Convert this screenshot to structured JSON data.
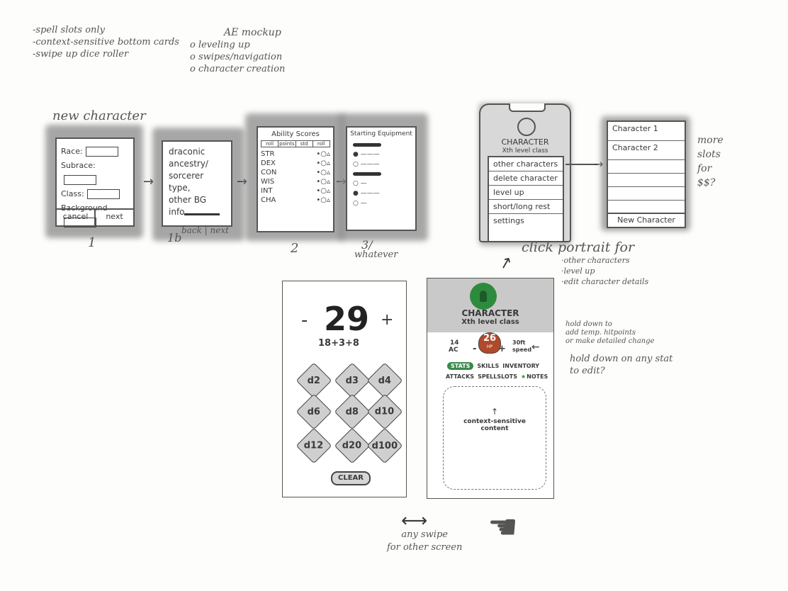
{
  "notes_left": [
    "-spell slots only",
    "-context-sensitive bottom cards",
    "-swipe up dice roller"
  ],
  "ae_mockup": {
    "title": "AE mockup",
    "items": [
      "o leveling up",
      "o swipes/navigation",
      "o character creation"
    ]
  },
  "new_character": {
    "title": "new character",
    "screen1": {
      "fields": [
        "Race:",
        "Subrace:",
        "Class:",
        "Background"
      ],
      "cancel": "cancel",
      "next": "next",
      "number": "1"
    },
    "screen1b": {
      "lines": [
        "draconic",
        "ancestry/",
        "sorcerer type,",
        "other BG",
        "info"
      ],
      "caption": "back | next",
      "number": "1b"
    },
    "screen2": {
      "title": "Ability Scores",
      "tabs": [
        "roll",
        "points",
        "std",
        "roll"
      ],
      "stats": [
        "STR",
        "DEX",
        "CON",
        "WIS",
        "INT",
        "CHA"
      ],
      "number": "2"
    },
    "screen3": {
      "title": "Starting Equipment",
      "number": "3/",
      "caption": "whatever"
    }
  },
  "character_menu": {
    "name": "CHARACTER",
    "sub": "Xth level class",
    "items": [
      "other characters",
      "delete character",
      "level up",
      "short/long rest",
      "settings"
    ],
    "list": [
      "Character 1",
      "Character 2",
      "",
      "",
      ""
    ],
    "new_character": "New Character",
    "more_slots": [
      "more",
      "slots",
      "for",
      "$$?"
    ]
  },
  "click_portrait": {
    "title": "click portrait for",
    "items": [
      "·other characters",
      "·level up",
      "·edit character details"
    ]
  },
  "dice_roller": {
    "minus": "-",
    "total": "29",
    "plus": "+",
    "formula": "18+3+8",
    "dice": [
      "d2",
      "d3",
      "d4",
      "d6",
      "d8",
      "d10",
      "d12",
      "d20",
      "d100"
    ],
    "clear": "CLEAR"
  },
  "main_screen": {
    "name": "CHARACTER",
    "sub": "Xth level class",
    "ac_value": "14",
    "ac_label": "AC",
    "hp_value": "26",
    "hp_label": "HP",
    "minus": "-",
    "plus": "+",
    "speed_value": "30ft",
    "speed_label": "speed",
    "tabs_row1": [
      "STATS",
      "SKILLS",
      "INVENTORY"
    ],
    "tabs_row2": [
      "ATTACKS",
      "SPELLSLOTS",
      "NOTES"
    ],
    "content": "context-sensitive content",
    "content_arrow": "↑"
  },
  "annotations": {
    "hold_hp": [
      "hold down to",
      "add temp. hitpoints",
      "or make detailed change"
    ],
    "hold_stat": [
      "hold down on any stat",
      "to edit?"
    ],
    "swipe": [
      "any swipe",
      "for other screen"
    ]
  }
}
